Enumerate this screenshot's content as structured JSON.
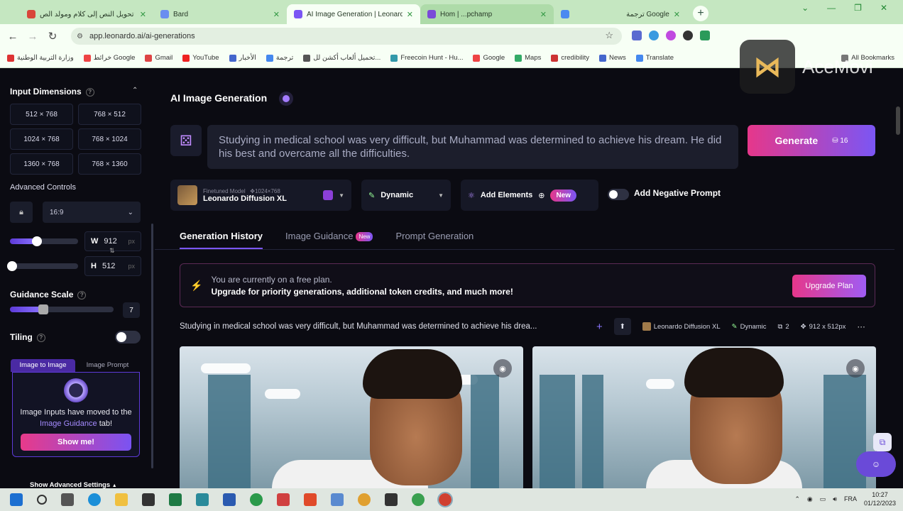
{
  "browser": {
    "tabs": [
      {
        "title": "تحويل النص إلى كلام ومولد الص",
        "favicon_color": "#d9463a"
      },
      {
        "title": "Bard",
        "favicon_color": "#6a8ef0"
      },
      {
        "title": "AI Image Generation | Leonardo",
        "favicon_color": "#7b56f4"
      },
      {
        "title": "Hom  | ...pchamp",
        "favicon_color": "#7a4ad8"
      },
      {
        "title": "ترجمة Google",
        "favicon_color": "#4a8af0"
      }
    ],
    "url": "app.leonardo.ai/ai-generations",
    "bookmarks": [
      {
        "label": "وزارة التربية الوطنية",
        "color": "#d33"
      },
      {
        "label": "خرائط Google",
        "color": "#e44"
      },
      {
        "label": "Gmail",
        "color": "#d44"
      },
      {
        "label": "YouTube",
        "color": "#e22"
      },
      {
        "label": "الأخبار",
        "color": "#46c"
      },
      {
        "label": "ترجمة",
        "color": "#48e"
      },
      {
        "label": "تحميل ألعاب أكشن لل...",
        "color": "#555"
      },
      {
        "label": "Freecoin Hunt - Hu...",
        "color": "#39a"
      },
      {
        "label": "Google",
        "color": "#e44"
      },
      {
        "label": "Maps",
        "color": "#3a6"
      },
      {
        "label": "credibility",
        "color": "#c33"
      },
      {
        "label": "News",
        "color": "#46c"
      },
      {
        "label": "Translate",
        "color": "#48e"
      },
      {
        "label": "All Bookmarks",
        "color": "#777"
      }
    ],
    "colors": {
      "frame": "#c5e7c1",
      "toolbar": "#f7fff5"
    }
  },
  "watermark": {
    "text": "AceMovi"
  },
  "sidebar": {
    "input_dimensions_title": "Input Dimensions",
    "dimensions": [
      "512 × 768",
      "768 × 512",
      "1024 × 768",
      "768 × 1024",
      "1360 × 768",
      "768 × 1360"
    ],
    "advanced_controls": "Advanced Controls",
    "aspect_ratio": "16:9",
    "width": {
      "label": "W",
      "value": "912",
      "unit": "px",
      "slider_fraction": 0.38
    },
    "height": {
      "label": "H",
      "value": "512",
      "unit": "px",
      "slider_fraction": 0.0
    },
    "guidance_scale": {
      "title": "Guidance Scale",
      "value": "7",
      "slider_fraction": 0.32
    },
    "tiling": {
      "title": "Tiling",
      "on": false
    },
    "image_tabs": [
      "Image to Image",
      "Image Prompt"
    ],
    "image_moved_prefix": "Image Inputs have moved to the ",
    "image_moved_link": "Image Guidance",
    "image_moved_suffix": " tab!",
    "show_me": "Show me!",
    "show_advanced": "Show Advanced Settings"
  },
  "main": {
    "title": "AI Image Generation",
    "prompt": "Studying in medical school was very difficult, but Muhammad was determined to achieve his dream. He did his best and overcame all the difficulties.",
    "generate_label": "Generate",
    "generate_cost": "16",
    "model": {
      "caption": "Finetuned Model",
      "size": "1024×768",
      "name": "Leonardo Diffusion XL"
    },
    "style": "Dynamic",
    "add_elements": "Add Elements",
    "new_badge": "New",
    "negative_prompt": "Add Negative Prompt",
    "tabs": [
      "Generation History",
      "Image Guidance",
      "Prompt Generation"
    ],
    "tab_new": "New",
    "plan": {
      "line1": "You are currently on a free plan.",
      "line2": "Upgrade for priority generations, additional token credits, and much more!",
      "button": "Upgrade Plan"
    },
    "history": {
      "prompt": "Studying in medical school was very difficult, but Muhammad was determined to achieve his drea...",
      "model": "Leonardo Diffusion XL",
      "style": "Dynamic",
      "count": "2",
      "size": "912 x 512px"
    },
    "accent": "#7b56f4",
    "pink": "#e6378a"
  },
  "taskbar": {
    "lang": "FRA",
    "time": "10:27",
    "date": "01/12/2023"
  }
}
